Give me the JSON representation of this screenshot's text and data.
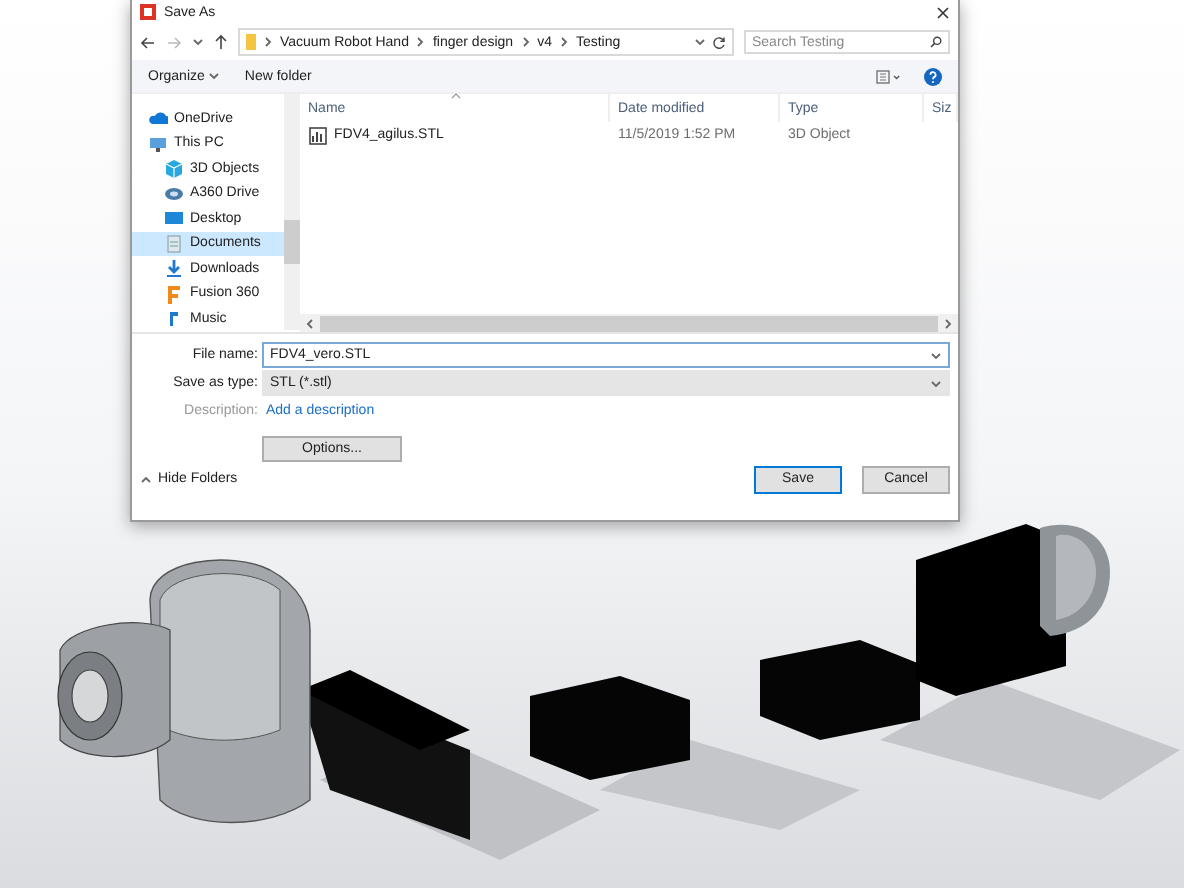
{
  "window": {
    "title": "Save As"
  },
  "address": {
    "path": [
      "Vacuum Robot Hand",
      "finger design",
      "v4",
      "Testing"
    ]
  },
  "search": {
    "placeholder": "Search Testing"
  },
  "toolbar": {
    "organize": "Organize",
    "new_folder": "New folder"
  },
  "sidebar": {
    "items": [
      {
        "label": "OneDrive",
        "kind": "cloud",
        "selected": false
      },
      {
        "label": "This PC",
        "kind": "pc",
        "selected": false
      },
      {
        "label": "3D Objects",
        "kind": "cube",
        "selected": false
      },
      {
        "label": "A360 Drive",
        "kind": "drive",
        "selected": false
      },
      {
        "label": "Desktop",
        "kind": "desktop",
        "selected": false
      },
      {
        "label": "Documents",
        "kind": "documents",
        "selected": true
      },
      {
        "label": "Downloads",
        "kind": "download",
        "selected": false
      },
      {
        "label": "Fusion 360",
        "kind": "fusion",
        "selected": false
      },
      {
        "label": "Music",
        "kind": "music",
        "selected": false
      }
    ]
  },
  "table": {
    "columns": [
      "Name",
      "Date modified",
      "Type",
      "Siz"
    ],
    "rows": [
      {
        "name": "FDV4_agilus.STL",
        "date": "11/5/2019 1:52 PM",
        "type": "3D Object"
      }
    ]
  },
  "form": {
    "file_name_label": "File name:",
    "file_name": "FDV4_vero.STL",
    "type_label": "Save as type:",
    "type_value": "STL (*.stl)",
    "description_label": "Description:",
    "description_link": "Add a description"
  },
  "options_button": "Options...",
  "hide_folders": "Hide Folders",
  "buttons": [
    {
      "label": "Save",
      "default": true
    },
    {
      "label": "Cancel",
      "default": false
    }
  ]
}
